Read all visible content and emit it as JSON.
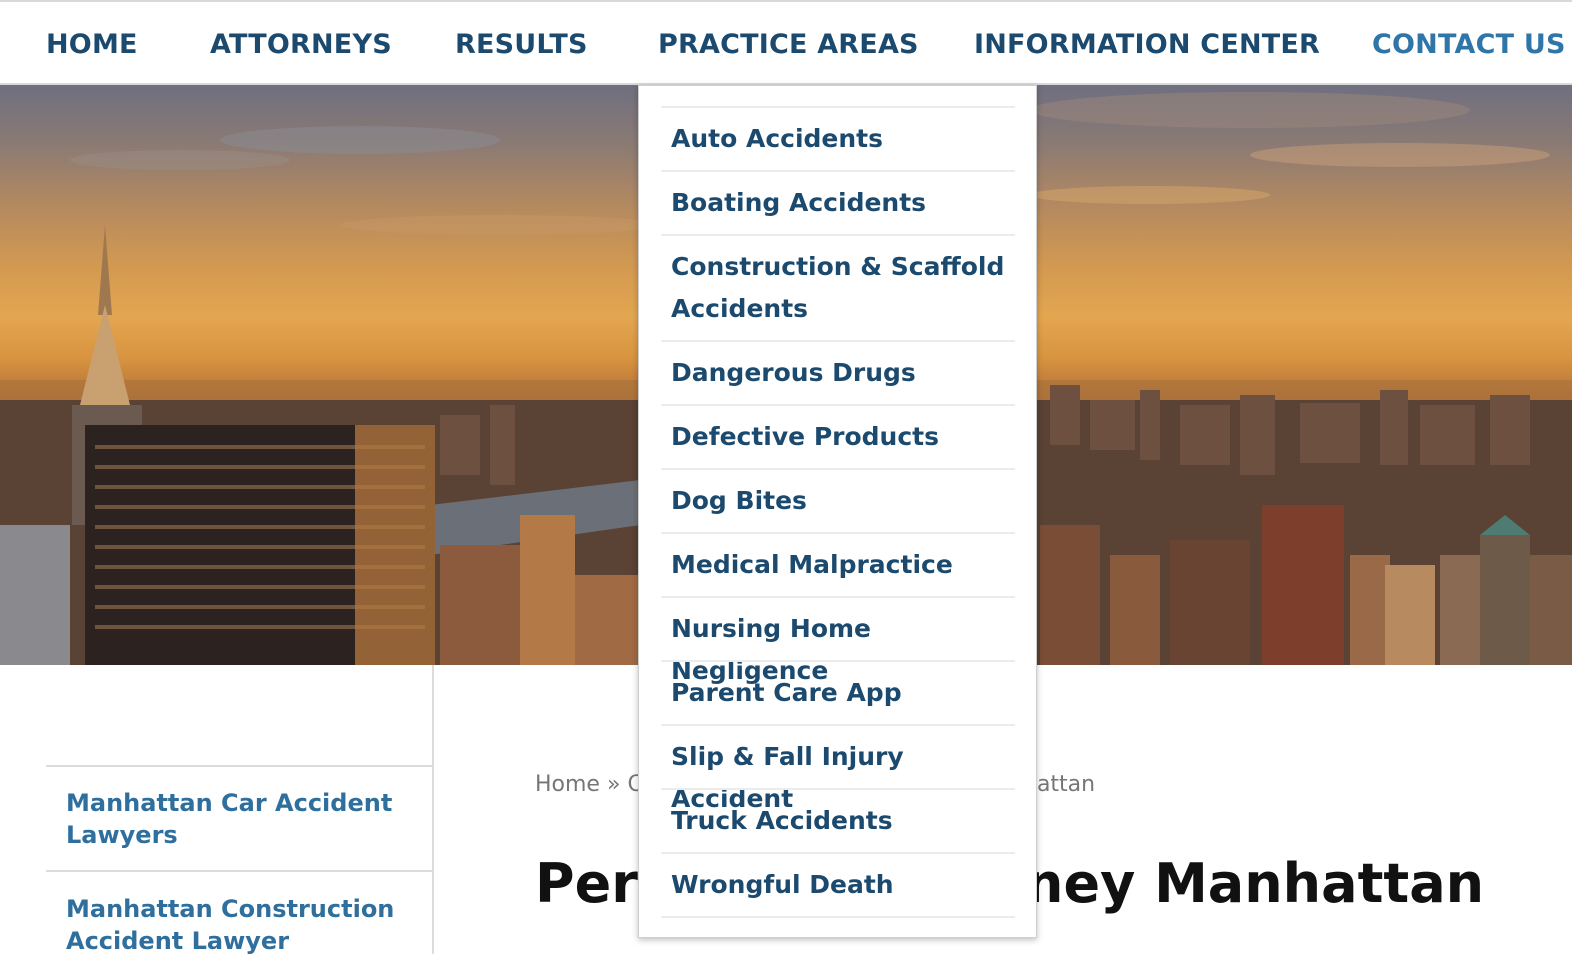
{
  "nav": {
    "items": [
      {
        "label": "HOME"
      },
      {
        "label": "ATTORNEYS"
      },
      {
        "label": "RESULTS"
      },
      {
        "label": "PRACTICE AREAS"
      },
      {
        "label": "INFORMATION CENTER"
      },
      {
        "label": "CONTACT US"
      }
    ]
  },
  "dropdown": {
    "items": [
      {
        "label": "Auto Accidents"
      },
      {
        "label": "Boating Accidents"
      },
      {
        "label": "Construction & Scaffold Accidents"
      },
      {
        "label": "Dangerous Drugs"
      },
      {
        "label": "Defective Products"
      },
      {
        "label": "Dog Bites"
      },
      {
        "label": "Medical Malpractice"
      },
      {
        "label": "Nursing Home Negligence"
      },
      {
        "label": "Parent Care App"
      },
      {
        "label": "Slip & Fall Injury Accident"
      },
      {
        "label": "Truck Accidents"
      },
      {
        "label": "Wrongful Death"
      }
    ]
  },
  "sidebar": {
    "links": [
      {
        "label": "Manhattan Car Accident Lawyers"
      },
      {
        "label": "Manhattan Construction Accident Lawyer"
      }
    ]
  },
  "breadcrumb": {
    "home": "Home",
    "sep": "»",
    "visible_fragment": "Co",
    "tail_fragment": "hattan"
  },
  "page": {
    "title_start": "Pers",
    "title_end": "ney Manhattan"
  },
  "colors": {
    "nav_text": "#1c4a6e",
    "nav_active": "#2f75a8",
    "sidebar_link": "#2f6f9e"
  }
}
